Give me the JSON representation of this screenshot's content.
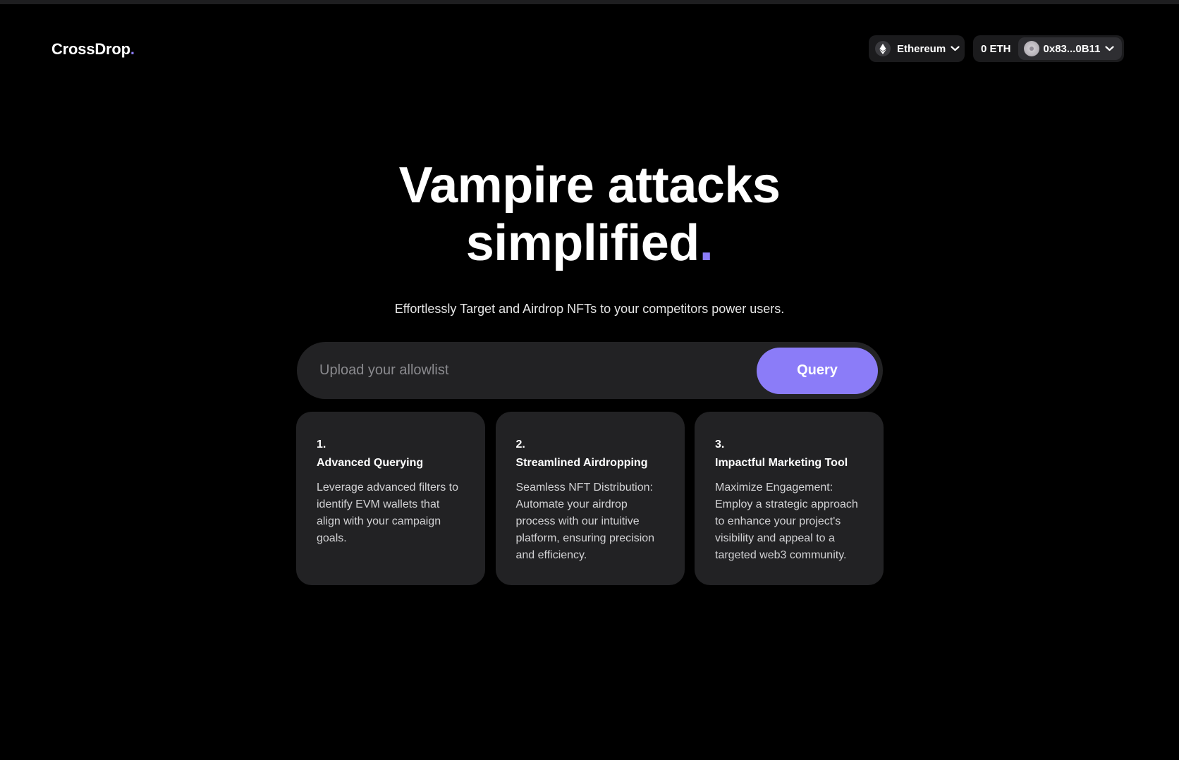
{
  "header": {
    "logo_text": "CrossDrop",
    "logo_dot": ".",
    "chain": {
      "label": "Ethereum",
      "icon": "ethereum-icon"
    },
    "wallet": {
      "balance": "0 ETH",
      "address": "0x83...0B11",
      "icon": "avatar"
    }
  },
  "hero": {
    "title_line1": "Vampire attacks",
    "title_line2": "simplified",
    "title_dot": ".",
    "subtitle": "Effortlessly Target and Airdrop NFTs to your competitors power users."
  },
  "query": {
    "placeholder": "Upload your allowlist",
    "button_label": "Query"
  },
  "cards": [
    {
      "number": "1.",
      "title": "Advanced Querying",
      "text": "Leverage advanced filters to identify EVM wallets that align with your campaign goals."
    },
    {
      "number": "2.",
      "title": "Streamlined Airdropping",
      "text": "Seamless NFT Distribution: Automate your airdrop process with our intuitive platform, ensuring precision and efficiency."
    },
    {
      "number": "3.",
      "title": "Impactful Marketing Tool",
      "text": "Maximize Engagement: Employ a strategic approach to enhance your project's visibility and appeal to a targeted web3 community."
    }
  ],
  "colors": {
    "accent": "#8b7cf8",
    "background": "#000000",
    "card": "#222224"
  }
}
